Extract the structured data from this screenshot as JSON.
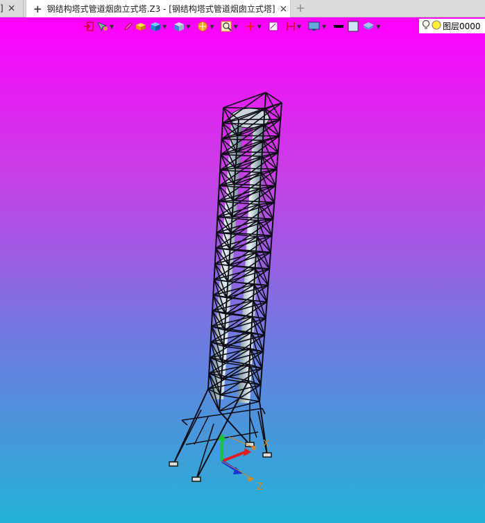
{
  "tabs": [
    {
      "label": "]",
      "close": "×"
    },
    {
      "label": "钢结构塔式管道烟囱立式塔.Z3 - [钢结构塔式管道烟囱立式塔]",
      "close": "×"
    }
  ],
  "new_tab": "+",
  "toolbar": {
    "icons": [
      "exit-view-icon",
      "select-filter-icon",
      "pencil-icon",
      "solid-block-icon",
      "cube-icon",
      "view-cube-icon",
      "render-sphere-icon",
      "zoom-icon",
      "move-axis-icon",
      "frame-icon",
      "section-icon",
      "display-icon",
      "line-color-icon",
      "fill-color-icon",
      "layer-stack-icon"
    ],
    "layer_label": "图层0000"
  },
  "axis": {
    "x": "X",
    "z": "Z"
  },
  "colors": {
    "bg_top": "#ff00ff",
    "bg_bottom": "#22b2d6"
  }
}
